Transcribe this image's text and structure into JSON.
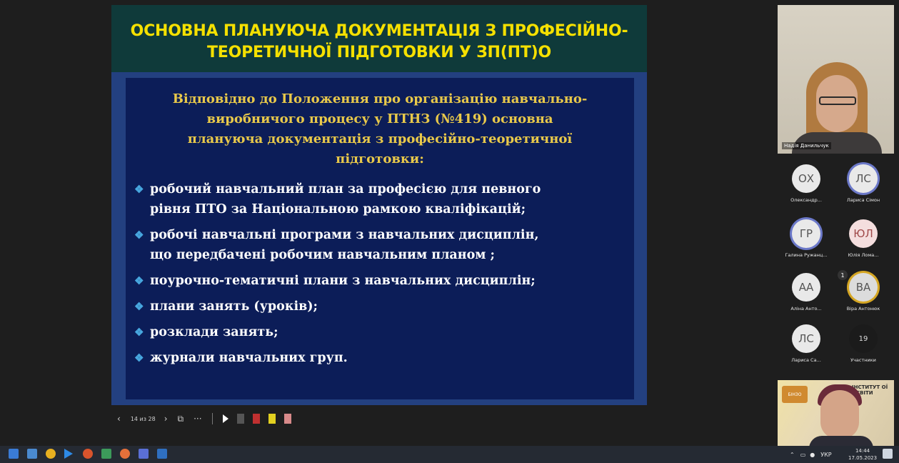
{
  "slide": {
    "title_line1": "ОСНОВНА ПЛАНУЮЧА ДОКУМЕНТАЦІЯ З ПРОФЕСІЙНО-",
    "title_line2": "ТЕОРЕТИЧНОЇ  ПІДГОТОВКИ У ЗП(ПТ)О",
    "intro_lines": [
      "Відповідно до Положення про організацію навчально-",
      "виробничого процесу у ПТНЗ (№419) основна",
      "плануюча  документація з професійно-теоретичної",
      "підготовки:"
    ],
    "items": [
      {
        "line1": "робочий навчальний план за професією для певного",
        "line2": "рівня ПТО за Національною рамкою кваліфікацій;"
      },
      {
        "line1": "робочі навчальні програми з навчальних дисциплін,",
        "line2": "що передбачені робочим навчальним планом ;"
      },
      {
        "line1": "поурочно-тематичні плани з навчальних дисциплін;",
        "line2": ""
      },
      {
        "line1": "плани занять (уроків);",
        "line2": ""
      },
      {
        "line1": "розклади занять;",
        "line2": ""
      },
      {
        "line1": "журнали навчальних груп.",
        "line2": ""
      }
    ]
  },
  "controls": {
    "prev": "‹",
    "page_info": "14 из 28",
    "next": "›",
    "more": "···"
  },
  "main_video": {
    "name": "Надія Данильчук"
  },
  "participants": [
    {
      "initials": "ОХ",
      "name": "Олександр..."
    },
    {
      "initials": "ЛС",
      "name": "Лариса Сімон"
    },
    {
      "initials": "ГР",
      "name": "Галина Ружанц..."
    },
    {
      "initials": "ЮЛ",
      "name": "Юлія Лома..."
    },
    {
      "initials": "АА",
      "name": "Аліна Анто..."
    },
    {
      "initials": "ВА",
      "name": "Віра Антонюк",
      "hand": "1"
    },
    {
      "initials": "ЛС",
      "name": "Лариса Са..."
    },
    {
      "initials": "19",
      "name": "Участники"
    }
  ],
  "bottom_video": {
    "logo": "БІНЗО",
    "org": "ІНСТИТУТ ОЇ ОСВІТИ"
  },
  "taskbar": {
    "lang": "УКР",
    "time": "14:44",
    "date": "17.05.2023"
  },
  "colors": {
    "title": "#f5e000",
    "intro": "#e9c94a",
    "bullet": "#48a8e0",
    "slide_bg": "#0c1d58"
  }
}
